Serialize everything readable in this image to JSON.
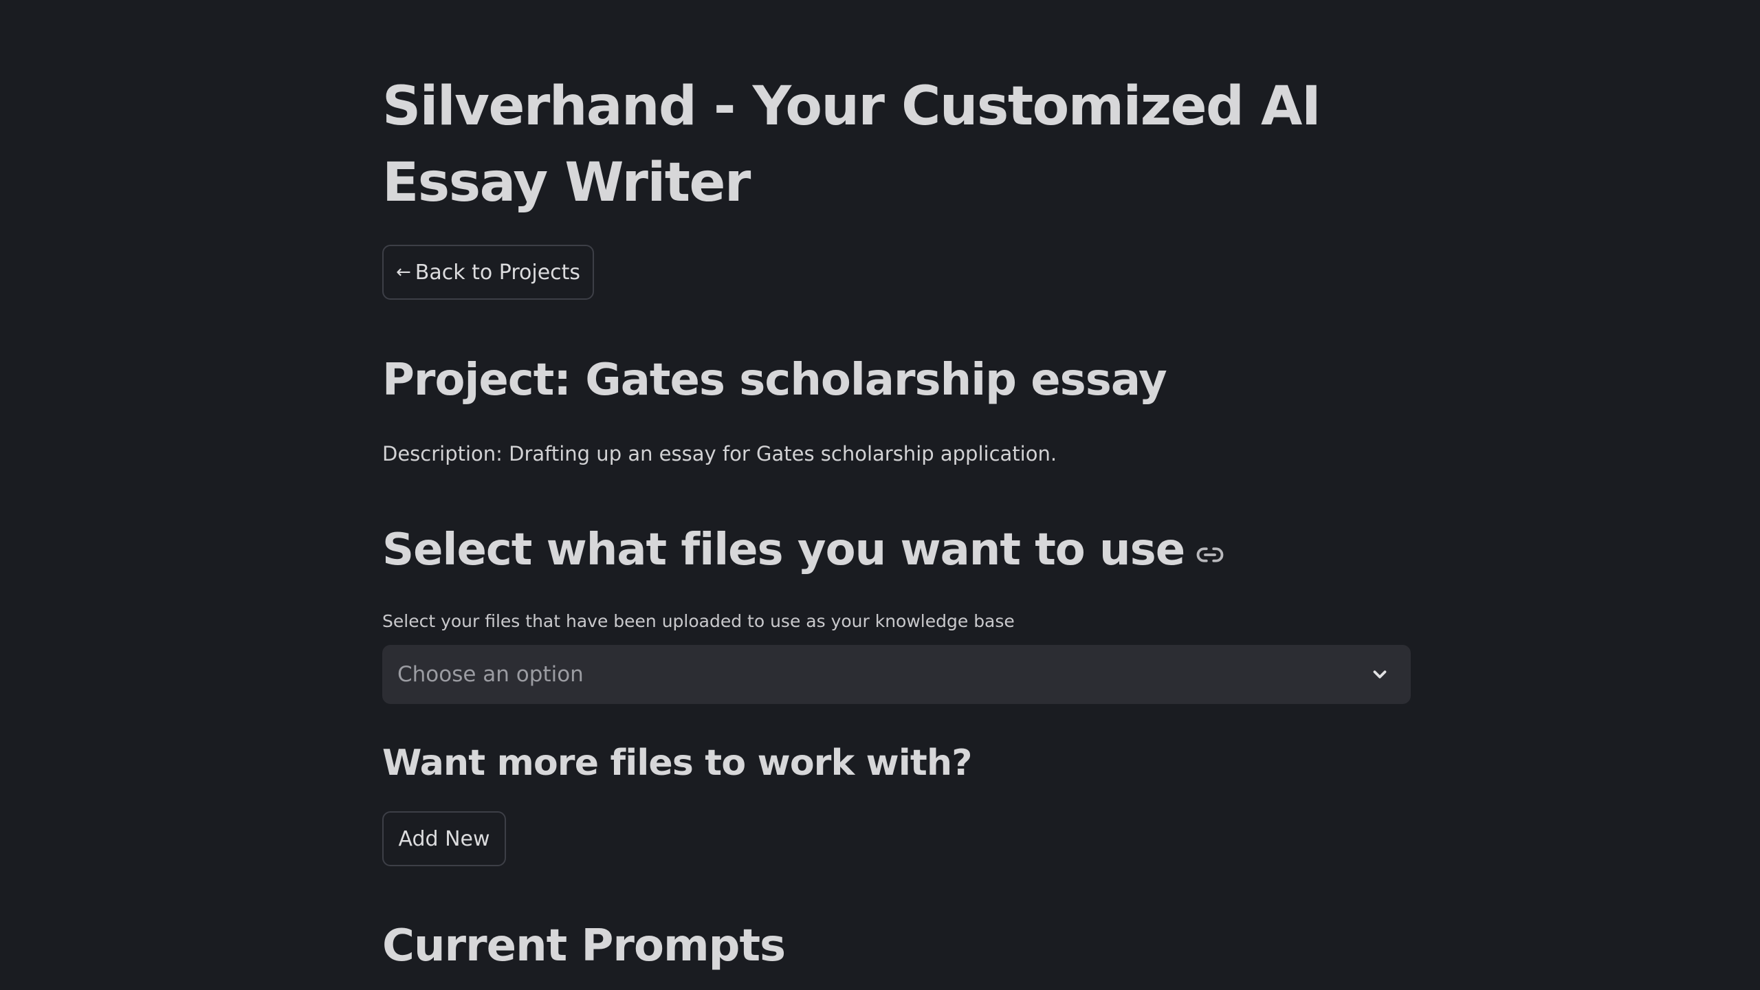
{
  "app": {
    "title": "Silverhand - Your Customized AI Essay Writer"
  },
  "navigation": {
    "back_arrow": "←",
    "back_label": "Back to Projects"
  },
  "project": {
    "title": "Project: Gates scholarship essay",
    "description": "Description: Drafting up an essay for Gates scholarship application."
  },
  "file_selection": {
    "heading": "Select what files you want to use",
    "heading_icon": "link-icon",
    "label": "Select your files that have been uploaded to use as your knowledge base",
    "placeholder": "Choose an option",
    "dropdown_icon": "chevron-down-icon"
  },
  "more_files": {
    "heading": "Want more files to work with?",
    "add_label": "Add New"
  },
  "prompts": {
    "heading": "Current Prompts"
  },
  "colors": {
    "background": "#1a1c21",
    "text": "#d7d7d9",
    "input_background": "#2c2d33",
    "button_border": "#3d3f47"
  }
}
